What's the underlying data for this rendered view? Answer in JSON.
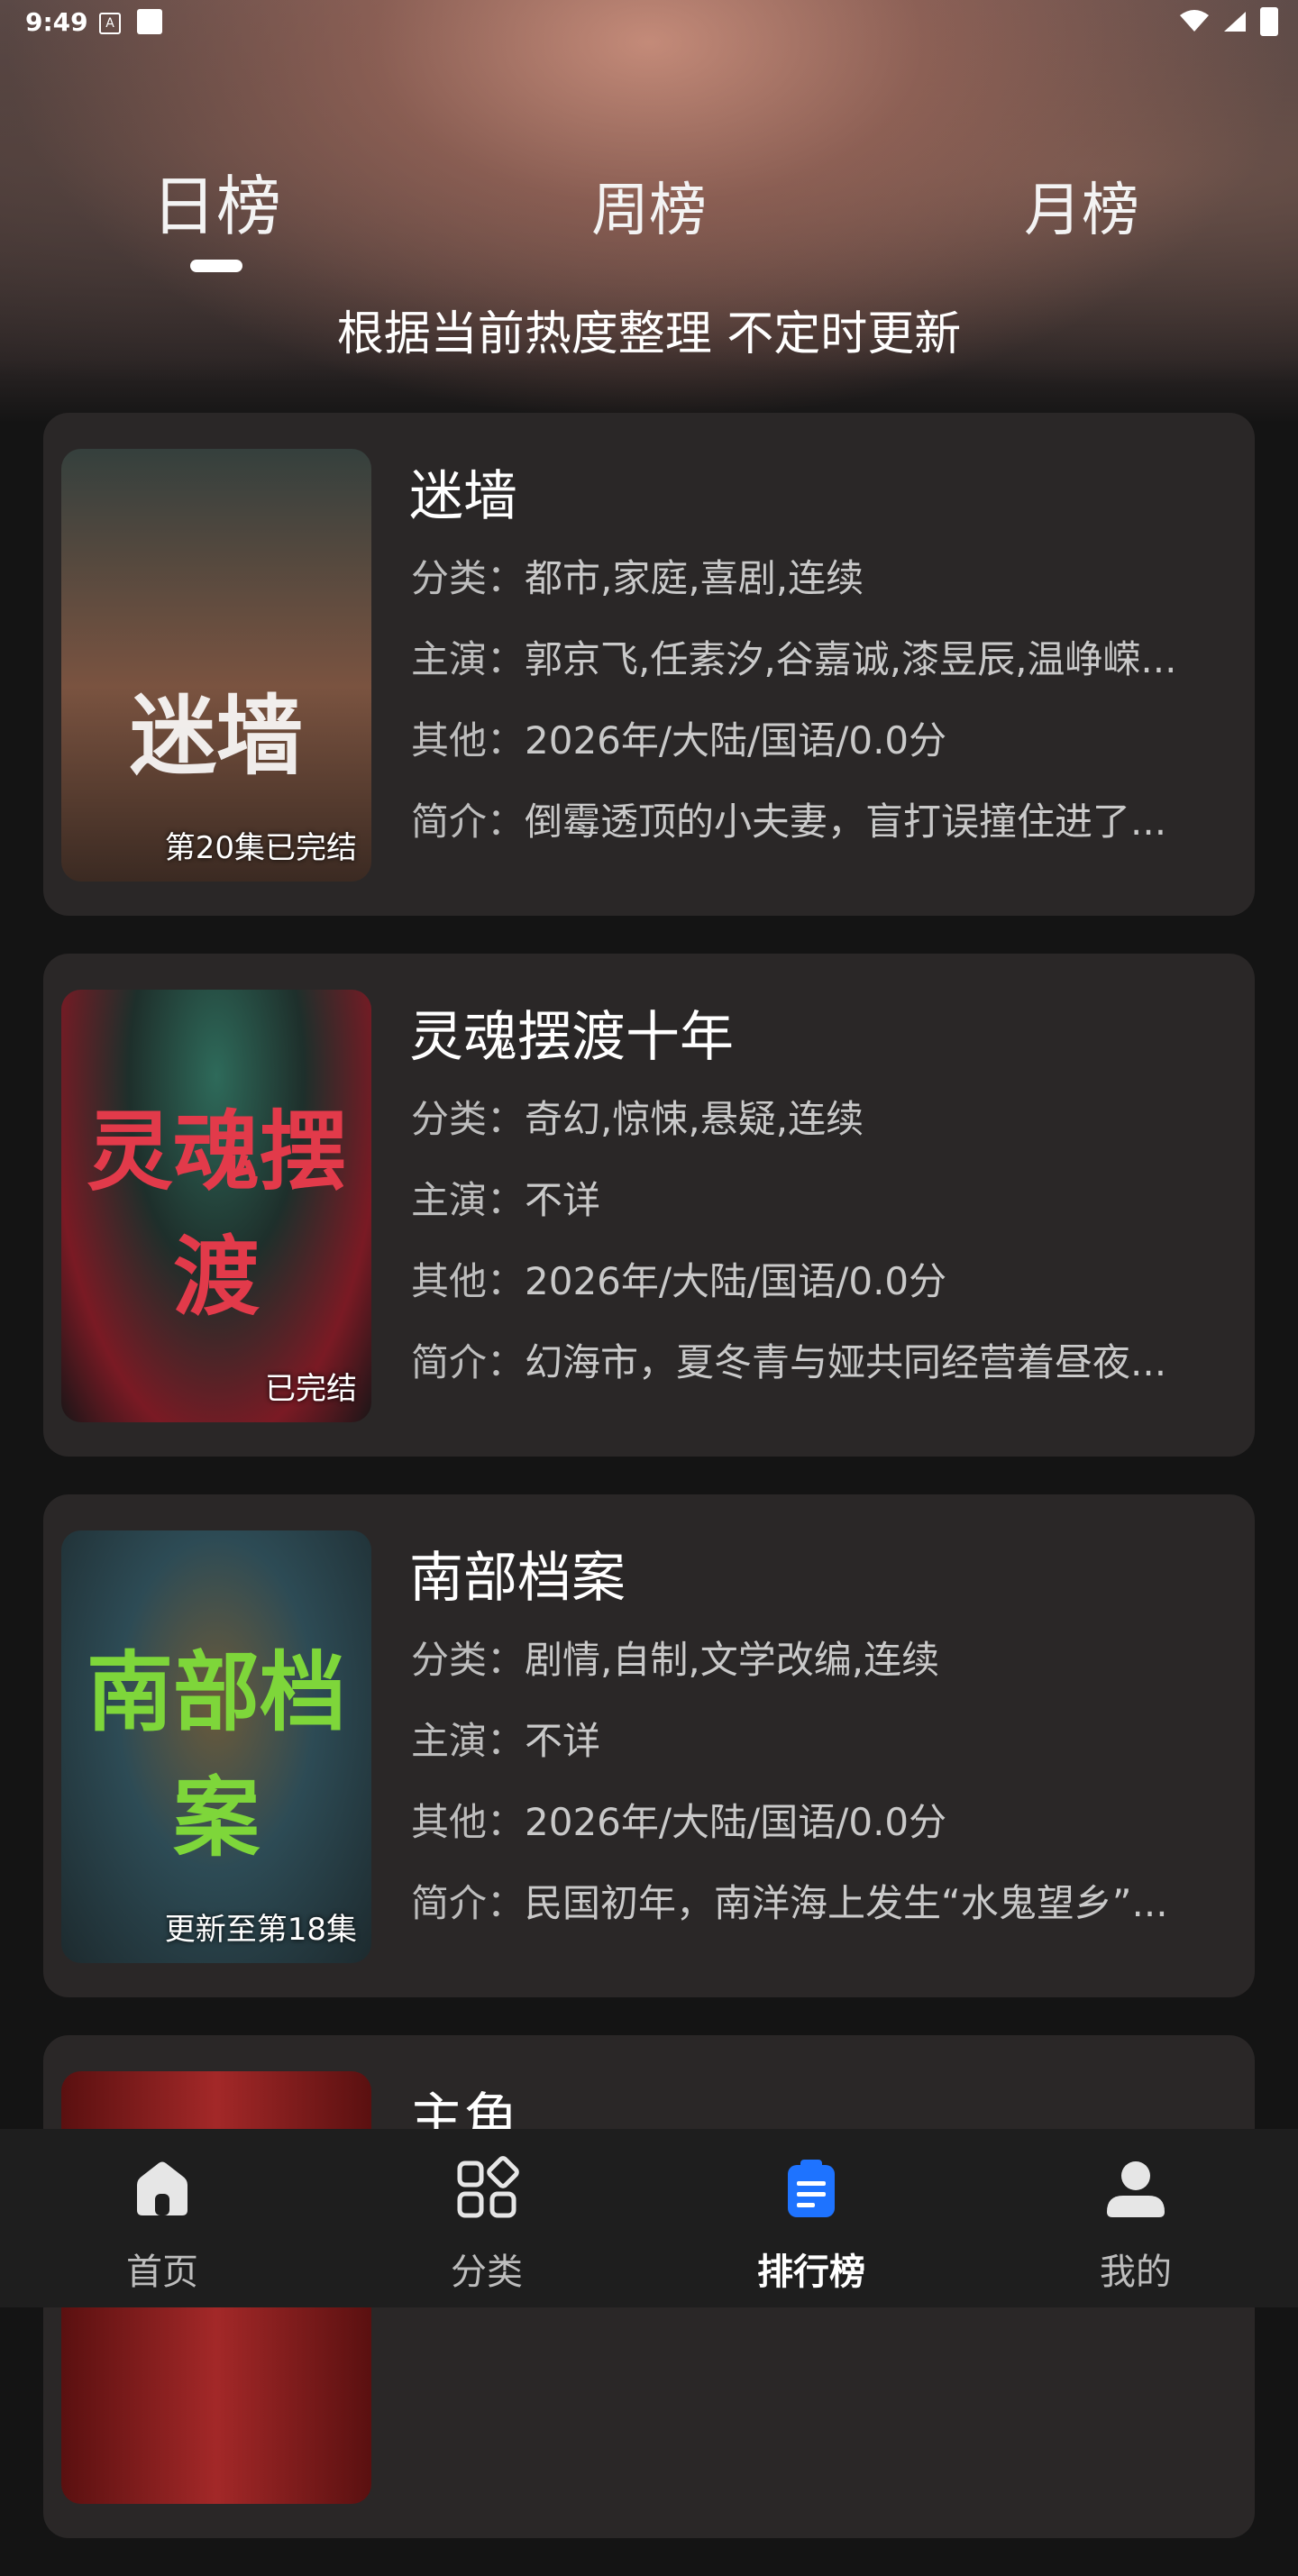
{
  "status": {
    "time": "9:49",
    "a_icon": "A"
  },
  "tabs": [
    {
      "label": "日榜",
      "active": true
    },
    {
      "label": "周榜"
    },
    {
      "label": "月榜"
    }
  ],
  "subtitle": "根据当前热度整理 不定时更新",
  "cards": [
    {
      "title": "迷墙",
      "poster_label": "第20集已完结",
      "poster_art": "迷墙",
      "category_key": "分类：",
      "category": "都市,家庭,喜剧,连续",
      "cast_key": "主演：",
      "cast": "郭京飞,任素汐,谷嘉诚,漆昱辰,温峥嵘...",
      "other_key": "其他：",
      "other": "2026年/大陆/国语/0.0分",
      "intro_key": "简介：",
      "intro": "倒霉透顶的小夫妻，盲打误撞住进了...",
      "poster_colors": [
        "#3d3a36",
        "#6b4a36",
        "#2b2520"
      ]
    },
    {
      "title": "灵魂摆渡十年",
      "poster_label": "已完结",
      "poster_art": "灵魂摆渡",
      "category_key": "分类：",
      "category": "奇幻,惊悚,悬疑,连续",
      "cast_key": "主演：",
      "cast": "不详",
      "other_key": "其他：",
      "other": "2026年/大陆/国语/0.0分",
      "intro_key": "简介：",
      "intro": "幻海市，夏冬青与娅共同经营着昼夜...",
      "poster_colors": [
        "#1f4a40",
        "#7a1a24",
        "#1a1517"
      ]
    },
    {
      "title": "南部档案",
      "poster_label": "更新至第18集",
      "poster_art": "南部档案",
      "category_key": "分类：",
      "category": "剧情,自制,文学改编,连续",
      "cast_key": "主演：",
      "cast": "不详",
      "other_key": "其他：",
      "other": "2026年/大陆/国语/0.0分",
      "intro_key": "简介：",
      "intro": "民国初年，南洋海上发生“水鬼望乡”...",
      "poster_colors": [
        "#2d4b55",
        "#5b4a30",
        "#1d2a2e"
      ]
    },
    {
      "title": "主角",
      "poster_label": "",
      "poster_art": "",
      "category_key": "",
      "category": "",
      "cast_key": "",
      "cast": "",
      "other_key": "",
      "other": "",
      "intro_key": "",
      "intro": "",
      "poster_colors": [
        "#7a1a1a",
        "#a32828",
        "#3d0d0d"
      ]
    }
  ],
  "bottom_nav": [
    {
      "label": "首页",
      "icon": "home-icon"
    },
    {
      "label": "分类",
      "icon": "category-icon"
    },
    {
      "label": "排行榜",
      "icon": "ranking-icon",
      "active": true
    },
    {
      "label": "我的",
      "icon": "profile-icon"
    }
  ],
  "colors": {
    "accent": "#1e73ff",
    "card_bg": "#2a2727"
  }
}
